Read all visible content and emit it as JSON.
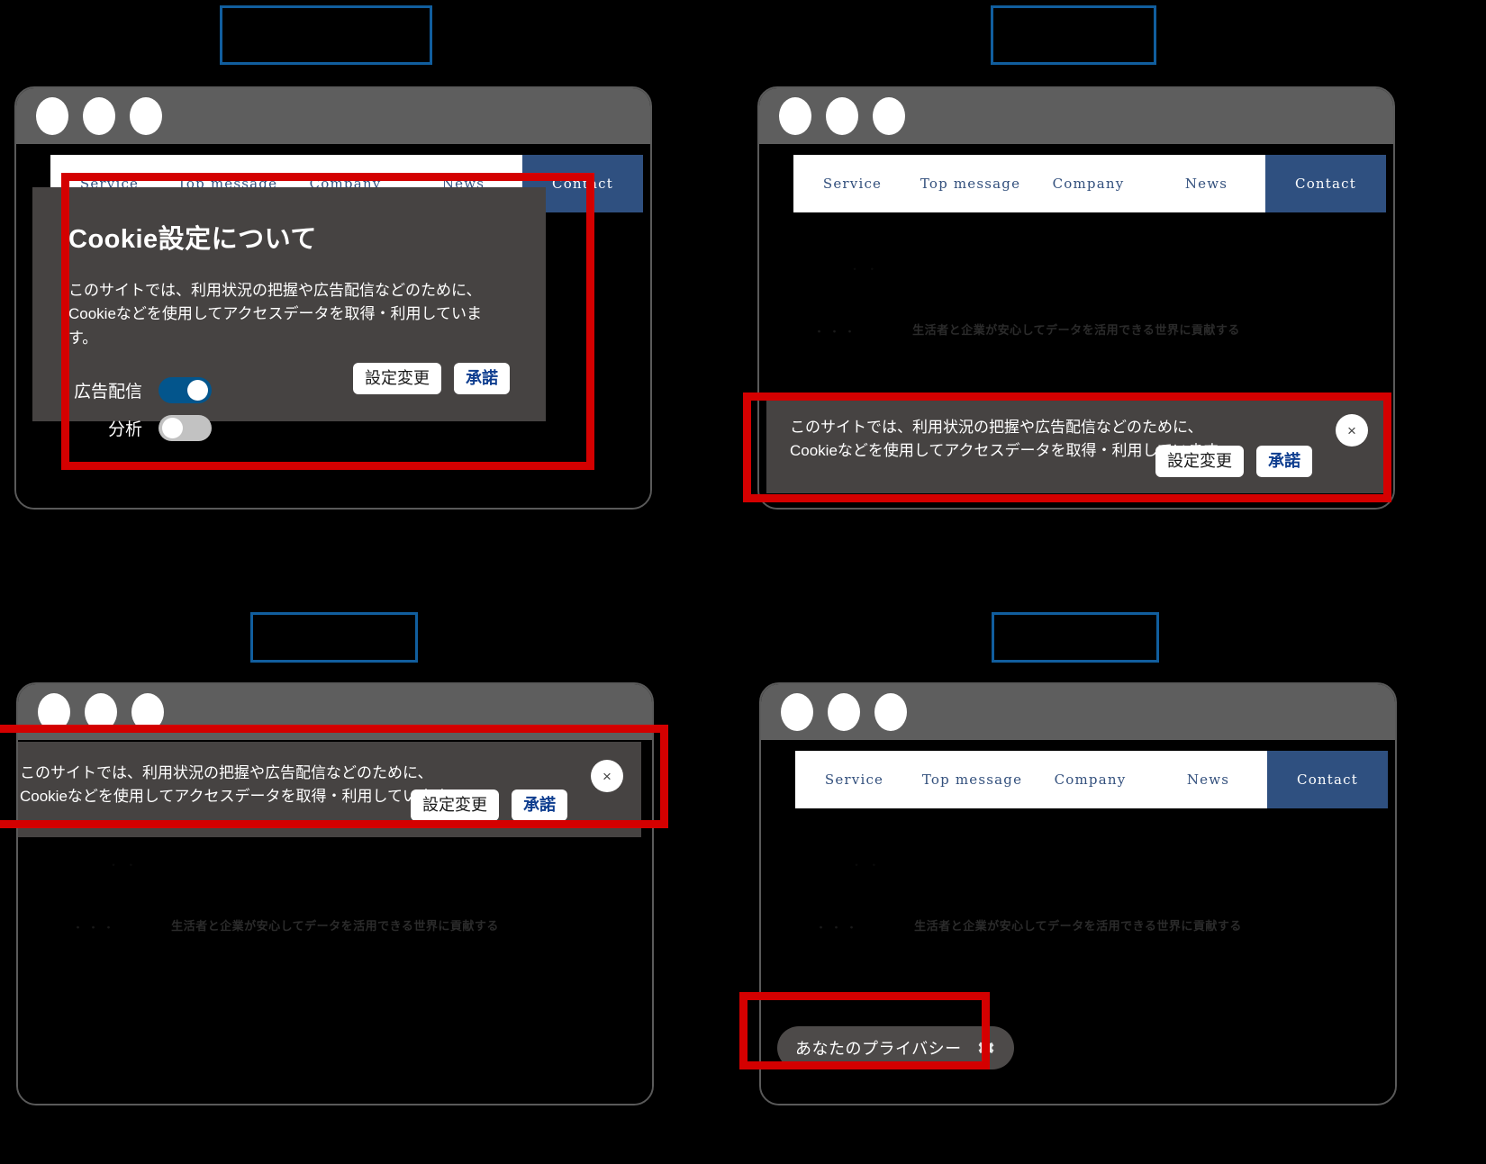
{
  "colors": {
    "highlight": "#d40000",
    "caption_border": "#115E9E",
    "nav_accent": "#2f5080",
    "toggle_on": "#03558c",
    "toggle_off": "#c2c2c2",
    "dialog_bg": "#464342",
    "primary_text": "#0e3d8f"
  },
  "site": {
    "nav": {
      "links": [
        "Service",
        "Top message",
        "Company",
        "News"
      ],
      "cta": "Contact"
    },
    "hero": {
      "tagline": "生活者と企業が安心してデータを活用できる世界に貢献する",
      "dots": "・・・",
      "corner": "・ ・"
    }
  },
  "consent": {
    "body": "このサイトでは、利用状況の把握や広告配信などのために、\nCookieなどを使用してアクセスデータを取得・利用しています。",
    "settings_label": "設定変更",
    "accept_label": "承諾",
    "close_label": "×",
    "close_icon": "close-icon"
  },
  "modal": {
    "title": "Cookie設定について",
    "body": "このサイトでは、利用状況の把握や広告配信などのために、\nCookieなどを使用してアクセスデータを取得・利用しています。",
    "toggles": [
      {
        "label": "広告配信",
        "state": "on"
      },
      {
        "label": "分析",
        "state": "off"
      }
    ],
    "settings_label": "設定変更",
    "accept_label": "承諾"
  },
  "privacy_pill": {
    "label": "あなたのプライバシー",
    "icon": "gear-icon"
  },
  "panels": [
    {
      "id": "panel-1",
      "caption": ""
    },
    {
      "id": "panel-2",
      "caption": ""
    },
    {
      "id": "panel-3",
      "caption": ""
    },
    {
      "id": "panel-4",
      "caption": ""
    }
  ]
}
